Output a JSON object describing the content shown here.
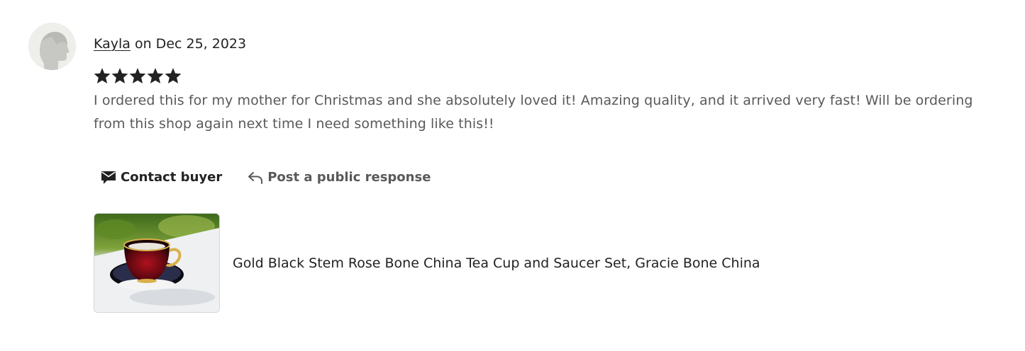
{
  "review": {
    "reviewer_name": "Kayla",
    "date_text": " on Dec 25, 2023",
    "rating": 5,
    "rating_max": 5,
    "text": "I ordered this for my mother for Christmas and she absolutely loved it! Amazing quality, and it arrived very fast! Will be ordering from this shop again next time I need something like this!!"
  },
  "actions": {
    "contact_label": "Contact buyer",
    "contact_icon": "envelope-icon",
    "respond_label": "Post a public response",
    "respond_icon": "reply-arrow-icon"
  },
  "listing": {
    "title": "Gold Black Stem Rose Bone China Tea Cup and Saucer Set, Gracie Bone China",
    "image": "tea-cup-photo"
  },
  "colors": {
    "text_primary": "#222222",
    "text_secondary": "#595959",
    "avatar_bg": "#eeeeea",
    "star": "#222222"
  }
}
